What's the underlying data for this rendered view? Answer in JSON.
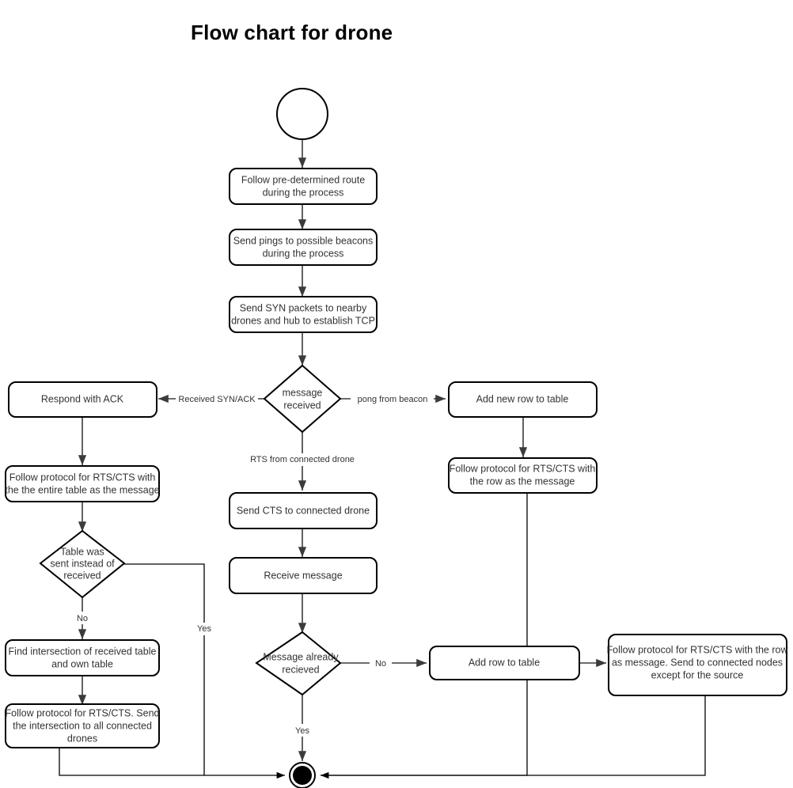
{
  "title": "Flow chart for drone",
  "chart_data": {
    "type": "diagram",
    "title": "Flow chart for drone",
    "diagram_kind": "flowchart",
    "nodes": [
      {
        "id": "start",
        "shape": "start-circle",
        "label": ""
      },
      {
        "id": "route",
        "shape": "rounded-box",
        "label": "Follow pre-determined route during the process",
        "lines": [
          "Follow pre-determined route",
          "during the process"
        ]
      },
      {
        "id": "pings",
        "shape": "rounded-box",
        "label": "Send pings to possible beacons during the process",
        "lines": [
          "Send pings to possible beacons",
          "during the process"
        ]
      },
      {
        "id": "syn",
        "shape": "rounded-box",
        "label": "Send SYN packets to nearby drones and hub to establish TCP",
        "lines": [
          "Send SYN packets to nearby",
          "drones and hub to establish TCP"
        ]
      },
      {
        "id": "msgrecv",
        "shape": "diamond",
        "label": "message received",
        "lines": [
          "message",
          "received"
        ]
      },
      {
        "id": "ack",
        "shape": "rounded-box",
        "label": "Respond with ACK",
        "lines": [
          "Respond with ACK"
        ]
      },
      {
        "id": "proto_table",
        "shape": "rounded-box",
        "label": "Follow protocol for RTS/CTS with the the entire table as the message",
        "lines": [
          "Follow protocol for RTS/CTS with",
          "the the entire table as the message"
        ]
      },
      {
        "id": "table_sent",
        "shape": "diamond",
        "label": "Table was sent instead of received",
        "lines": [
          "Table was",
          "sent instead of",
          "received"
        ]
      },
      {
        "id": "intersect",
        "shape": "rounded-box",
        "label": "Find intersection of received table and own table",
        "lines": [
          "Find intersection of received table",
          "and own table"
        ]
      },
      {
        "id": "send_intersect",
        "shape": "rounded-box",
        "label": "Follow protocol for RTS/CTS. Send the intersection to all connected drones",
        "lines": [
          "Follow protocol for RTS/CTS. Send",
          "the intersection to all connected",
          "drones"
        ]
      },
      {
        "id": "cts",
        "shape": "rounded-box",
        "label": "Send CTS to connected drone",
        "lines": [
          "Send CTS to connected drone"
        ]
      },
      {
        "id": "receive",
        "shape": "rounded-box",
        "label": "Receive message",
        "lines": [
          "Receive message"
        ]
      },
      {
        "id": "already",
        "shape": "diamond",
        "label": "Message already recieved",
        "lines": [
          "Message already",
          "recieved"
        ]
      },
      {
        "id": "addnewrow",
        "shape": "rounded-box",
        "label": "Add new row to table",
        "lines": [
          "Add new row to table"
        ]
      },
      {
        "id": "proto_row",
        "shape": "rounded-box",
        "label": "Follow protocol for RTS/CTS with the row as the message",
        "lines": [
          "Follow protocol for RTS/CTS with",
          "the row as the message"
        ]
      },
      {
        "id": "addrow",
        "shape": "rounded-box",
        "label": "Add row to table",
        "lines": [
          "Add row to table"
        ]
      },
      {
        "id": "proto_forward",
        "shape": "rounded-box",
        "label": "Follow protocol for RTS/CTS with the row as message. Send to connected nodes except for the source",
        "lines": [
          "Follow protocol for RTS/CTS with the row",
          "as message. Send to connected nodes",
          "except for the source"
        ]
      },
      {
        "id": "end",
        "shape": "end-circle",
        "label": ""
      }
    ],
    "edges": [
      {
        "from": "start",
        "to": "route",
        "label": ""
      },
      {
        "from": "route",
        "to": "pings",
        "label": ""
      },
      {
        "from": "pings",
        "to": "syn",
        "label": ""
      },
      {
        "from": "syn",
        "to": "msgrecv",
        "label": ""
      },
      {
        "from": "msgrecv",
        "to": "ack",
        "label": "Received SYN/ACK"
      },
      {
        "from": "msgrecv",
        "to": "addnewrow",
        "label": "pong from beacon"
      },
      {
        "from": "msgrecv",
        "to": "cts",
        "label": "RTS from connected drone"
      },
      {
        "from": "ack",
        "to": "proto_table",
        "label": ""
      },
      {
        "from": "proto_table",
        "to": "table_sent",
        "label": ""
      },
      {
        "from": "table_sent",
        "to": "intersect",
        "label": "No"
      },
      {
        "from": "table_sent",
        "to": "end",
        "label": "Yes"
      },
      {
        "from": "intersect",
        "to": "send_intersect",
        "label": ""
      },
      {
        "from": "send_intersect",
        "to": "end",
        "label": ""
      },
      {
        "from": "cts",
        "to": "receive",
        "label": ""
      },
      {
        "from": "receive",
        "to": "already",
        "label": ""
      },
      {
        "from": "already",
        "to": "addrow",
        "label": "No"
      },
      {
        "from": "already",
        "to": "end",
        "label": "Yes"
      },
      {
        "from": "addnewrow",
        "to": "proto_row",
        "label": ""
      },
      {
        "from": "proto_row",
        "to": "end",
        "label": ""
      },
      {
        "from": "addrow",
        "to": "proto_forward",
        "label": ""
      },
      {
        "from": "proto_forward",
        "to": "end",
        "label": ""
      }
    ],
    "edge_labels": [
      "Received SYN/ACK",
      "pong from beacon",
      "RTS from connected drone",
      "No",
      "Yes",
      "No",
      "Yes"
    ],
    "colors": {
      "background": "#ffffff",
      "node_stroke": "#000000",
      "node_fill": "#ffffff",
      "edge": "#3b3b3b",
      "text": "#333333",
      "title": "#000000"
    }
  }
}
